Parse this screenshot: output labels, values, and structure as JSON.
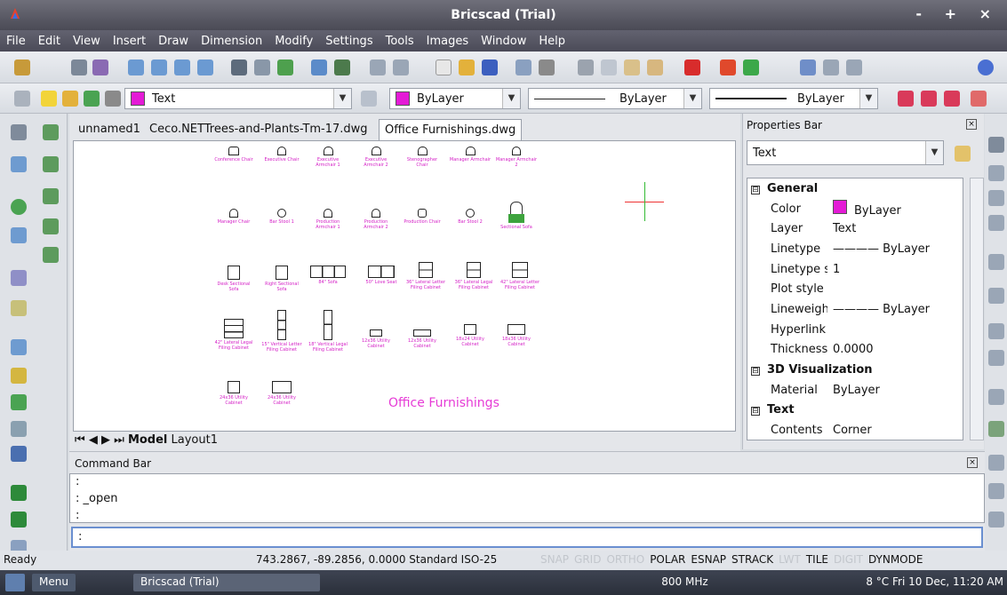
{
  "window": {
    "title": "Bricscad (Trial)",
    "controls": "- + ×"
  },
  "menu": [
    "File",
    "Edit",
    "View",
    "Insert",
    "Draw",
    "Dimension",
    "Modify",
    "Settings",
    "Tools",
    "Images",
    "Window",
    "Help"
  ],
  "properties_toolbar": {
    "layer": "Text",
    "color": "ByLayer",
    "linetype": "ByLayer",
    "lineweight": "ByLayer",
    "accent_color": "#e41bd6"
  },
  "tabs": [
    {
      "label": "unnamed1",
      "active": false
    },
    {
      "label": "Ceco.NETTrees-and-Plants-Tm-17.dwg",
      "active": false
    },
    {
      "label": "Office Furnishings.dwg",
      "active": true
    }
  ],
  "drawing": {
    "title": "Office Furnishings",
    "items": [
      "Conference Chair",
      "Executive Chair",
      "Executive Armchair 1",
      "Executive Armchair 2",
      "Stenographer Chair",
      "Manager Armchair",
      "Manager Armchair 2",
      "Manager Chair",
      "Bar Stool 1",
      "Production Armchair 1",
      "Production Armchair 2",
      "Production Chair",
      "Bar Stool 2",
      "Sectional Sofa",
      "Desk Sectional Sofa",
      "Right Sectional Sofa",
      "84\" Sofa",
      "50\" Love Seat",
      "36\" Lateral Letter Filing Cabinet",
      "36\" Lateral Legal Filing Cabinet",
      "42\" Lateral Letter Filing Cabinet",
      "42\" Lateral Legal Filing Cabinet",
      "15\" Vertical Letter Filing Cabinet",
      "18\" Vertical Legal Filing Cabinet",
      "12x36 Utility Cabinet",
      "12x36 Utility Cabinet",
      "18x24 Utility Cabinet",
      "18x36 Utility Cabinet",
      "24x36 Utility Cabinet",
      "24x36 Utility Cabinet"
    ],
    "layout_tabs": {
      "model": "Model",
      "layout": "Layout1"
    }
  },
  "properties_bar": {
    "header": "Properties Bar",
    "selection": "Text",
    "rows": [
      {
        "type": "section",
        "label": "General",
        "toggle": "⊟"
      },
      {
        "label": "Color",
        "value": "ByLayer",
        "swatch": true
      },
      {
        "label": "Layer",
        "value": "Text"
      },
      {
        "label": "Linetype",
        "value": "———— ByLayer"
      },
      {
        "label": "Linetype sca",
        "value": "1"
      },
      {
        "label": "Plot style",
        "value": ""
      },
      {
        "label": "Lineweight",
        "value": "———— ByLayer"
      },
      {
        "label": "Hyperlink",
        "value": ""
      },
      {
        "label": "Thickness",
        "value": "0.0000"
      },
      {
        "type": "section",
        "label": "3D Visualization",
        "toggle": "⊟"
      },
      {
        "label": "Material",
        "value": "ByLayer"
      },
      {
        "type": "section",
        "label": "Text",
        "toggle": "⊟"
      },
      {
        "label": "Contents",
        "value": "Corner"
      }
    ]
  },
  "command_bar": {
    "header": "Command Bar",
    "history": [
      ":",
      ": _open",
      ":"
    ],
    "prompt": ":"
  },
  "status": {
    "ready": "Ready",
    "coords": "743.2867, -89.2856, 0.0000 Standard ISO-25",
    "toggles": [
      {
        "label": "SNAP",
        "on": false
      },
      {
        "label": "GRID",
        "on": false
      },
      {
        "label": "ORTHO",
        "on": false
      },
      {
        "label": "POLAR",
        "on": true
      },
      {
        "label": "ESNAP",
        "on": true
      },
      {
        "label": "STRACK",
        "on": true
      },
      {
        "label": "LWT",
        "on": false
      },
      {
        "label": "TILE",
        "on": true
      },
      {
        "label": "DIGIT",
        "on": false
      },
      {
        "label": "DYNMODE",
        "on": true
      }
    ]
  },
  "taskbar": {
    "menu": "Menu",
    "task": "Bricscad (Trial)",
    "cpu": "800 MHz",
    "temp": "8 °C",
    "clock": "Fri 10 Dec, 11:20 AM"
  }
}
